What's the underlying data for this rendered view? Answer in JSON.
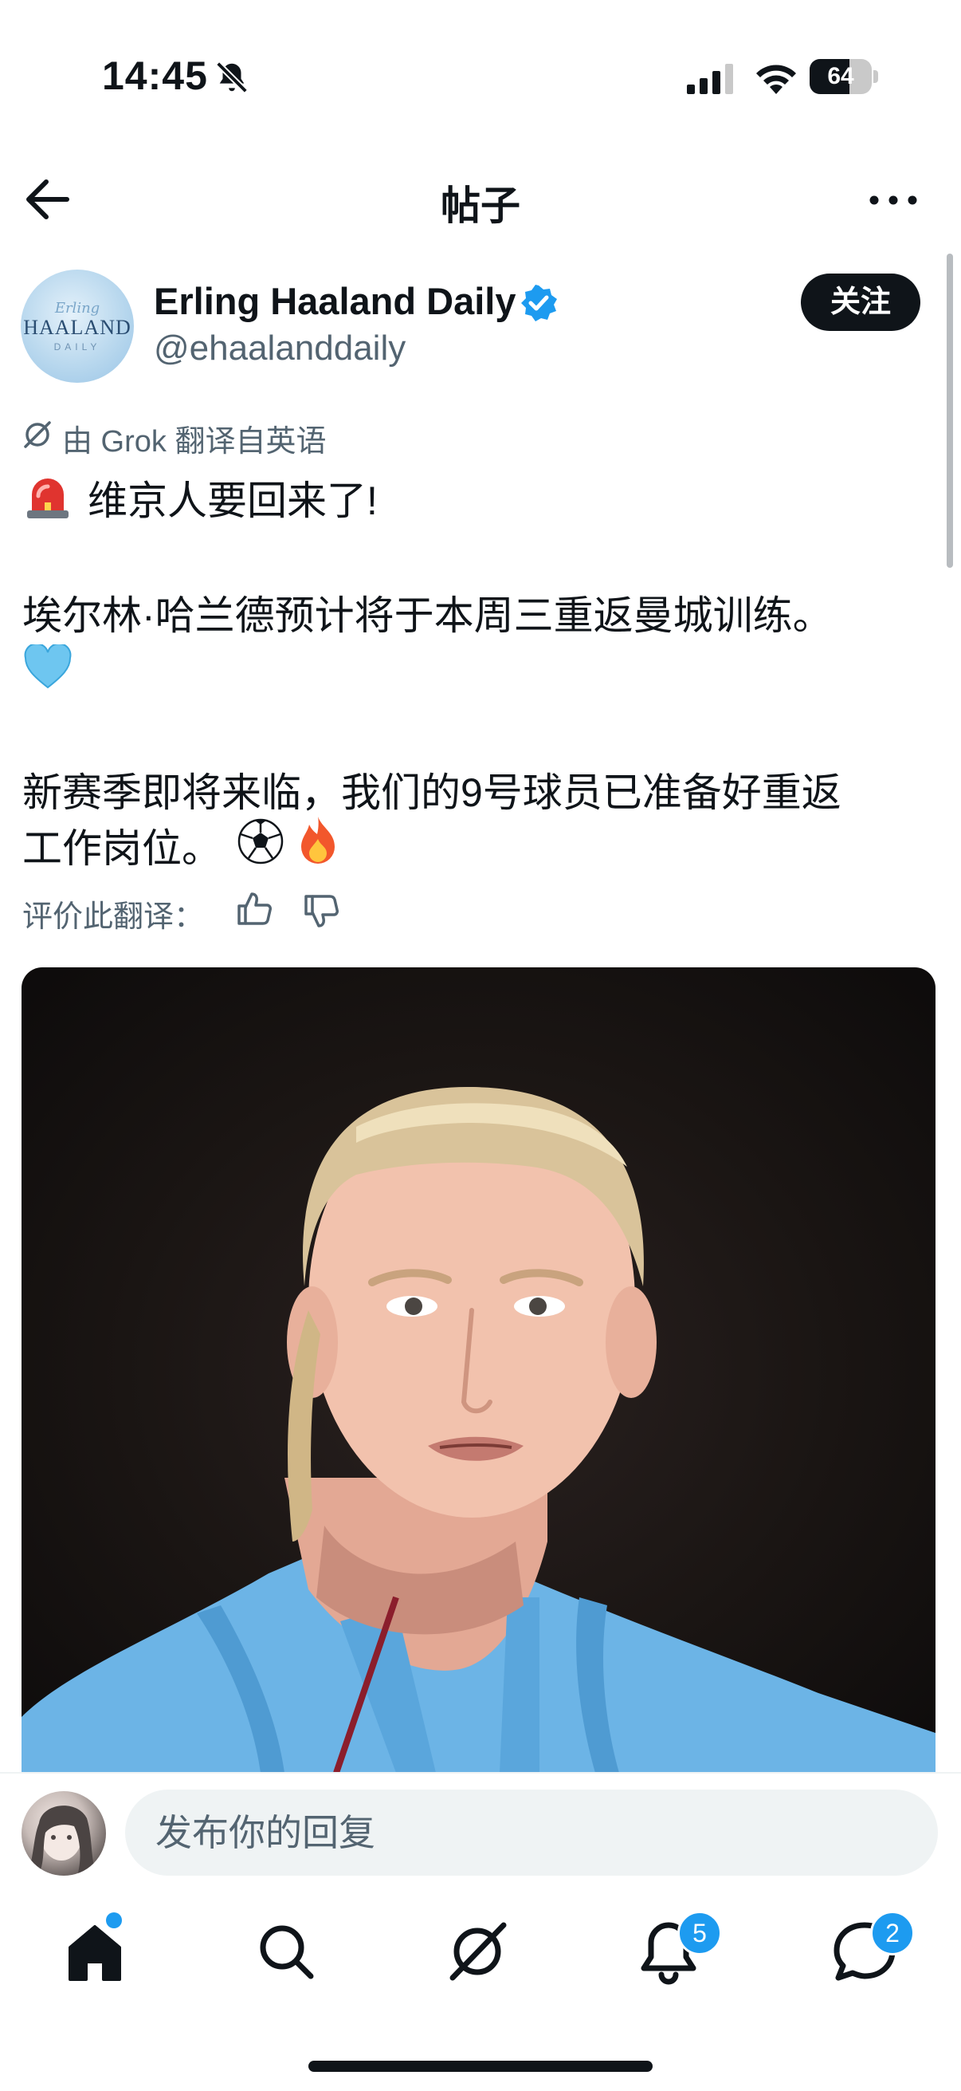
{
  "status_bar": {
    "time": "14:45",
    "battery": "64",
    "battery_level": 0.64,
    "icons": [
      "bell-slash-icon",
      "cellular-signal-icon",
      "wifi-icon",
      "battery-icon"
    ]
  },
  "header": {
    "title": "帖子",
    "back_icon": "arrow-left-icon",
    "more_icon": "more-horizontal-icon"
  },
  "post": {
    "author_name": "Erling Haaland Daily",
    "author_handle": "@ehaalanddaily",
    "avatar_text": {
      "line1": "Erling",
      "line2": "HAALAND",
      "line3": "DAILY"
    },
    "follow_label": "关注",
    "translation_note": "由 Grok 翻译自英语",
    "line1": "维京人要回来了!",
    "line2": "埃尔林·哈兰德预计将于本周三重返曼城训练。",
    "line3": "新赛季即将来临，我们的9号球员已准备好重返",
    "line4": "工作岗位。",
    "emojis": [
      "siren-icon",
      "blue-heart-icon",
      "soccer-ball-icon",
      "fire-icon"
    ],
    "rate_label": "评价此翻译：",
    "image": "player-photo"
  },
  "reply": {
    "placeholder": "发布你的回复"
  },
  "tab_bar": {
    "items": [
      {
        "name": "home",
        "icon": "home-icon",
        "has_dot": true
      },
      {
        "name": "search",
        "icon": "search-icon"
      },
      {
        "name": "grok",
        "icon": "grok-icon"
      },
      {
        "name": "notifications",
        "icon": "bell-icon",
        "badge": "5"
      },
      {
        "name": "messages",
        "icon": "chat-icon",
        "badge": "2"
      }
    ]
  },
  "colors": {
    "accent": "#1d9bf0",
    "text": "#0f1419",
    "secondary": "#536471"
  }
}
